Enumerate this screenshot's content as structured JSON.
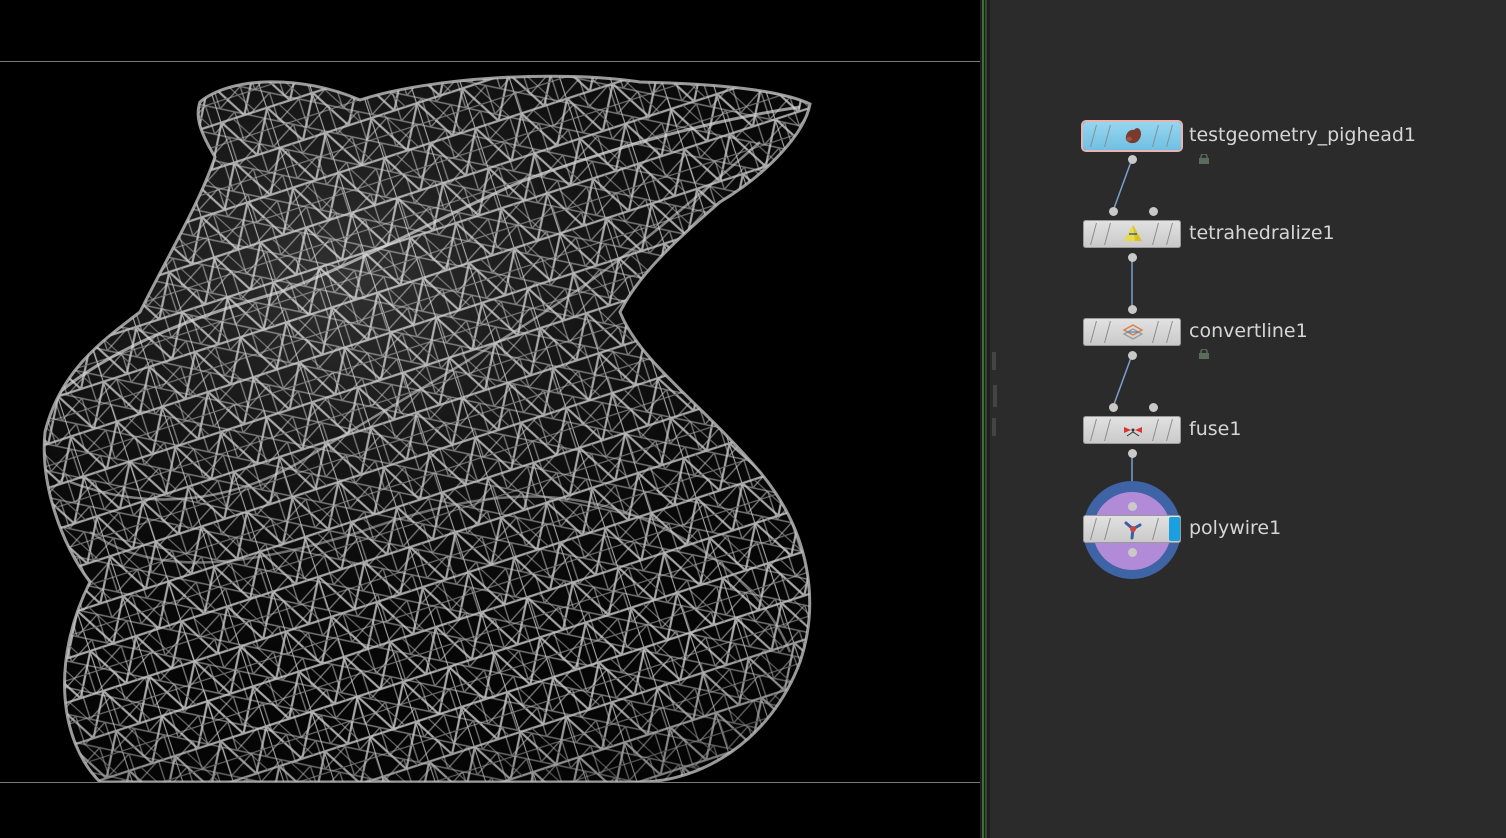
{
  "viewport": {
    "object": "wireframe-pighead"
  },
  "network": {
    "nodes": [
      {
        "id": "testgeometry_pighead1",
        "label": "testgeometry_pighead1",
        "icon": "pighead-icon",
        "selected": true,
        "locked": true
      },
      {
        "id": "tetrahedralize1",
        "label": "tetrahedralize1",
        "icon": "tetrahedralize-icon",
        "selected": false,
        "locked": false
      },
      {
        "id": "convertline1",
        "label": "convertline1",
        "icon": "convertline-icon",
        "selected": false,
        "locked": true
      },
      {
        "id": "fuse1",
        "label": "fuse1",
        "icon": "fuse-icon",
        "selected": false,
        "locked": false
      },
      {
        "id": "polywire1",
        "label": "polywire1",
        "icon": "polywire-icon",
        "selected": false,
        "locked": false,
        "display_flag": true
      }
    ]
  },
  "colors": {
    "viewport_bg": "#000000",
    "pane_bg": "#2b2b2b",
    "selected_node": "#7ccbe8",
    "display_flag": "#1aa0df",
    "wire": "#7aa0d0"
  }
}
